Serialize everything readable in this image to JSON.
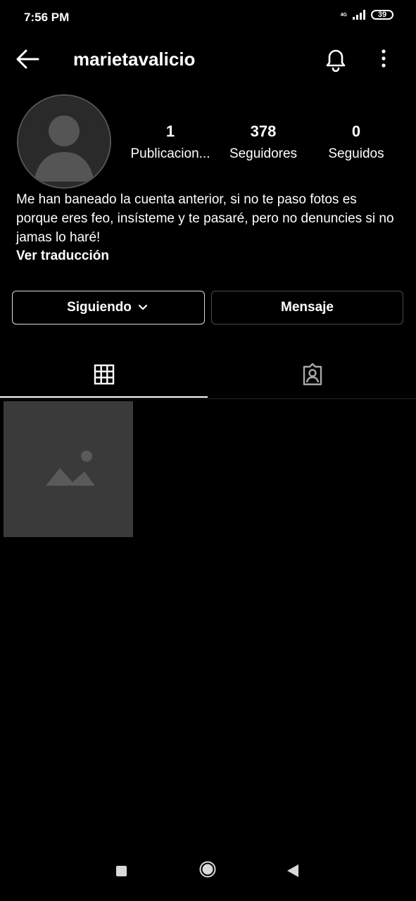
{
  "status_bar": {
    "time": "7:56 PM",
    "network": "4G",
    "battery": "39"
  },
  "header": {
    "username": "marietavalicio",
    "back_icon": "arrow-left-icon",
    "notifications_icon": "bell-icon",
    "more_icon": "more-vertical-icon"
  },
  "profile": {
    "avatar": "profile-photo",
    "stats": [
      {
        "value": "1",
        "label": "Publicacion..."
      },
      {
        "value": "378",
        "label": "Seguidores"
      },
      {
        "value": "0",
        "label": "Seguidos"
      }
    ],
    "bio": "Me han baneado la cuenta anterior, si no te paso fotos es porque eres feo, insísteme y te pasaré, pero no denuncies si no jamas lo haré!",
    "translate_link": "Ver traducción"
  },
  "actions": {
    "following_label": "Siguiendo",
    "message_label": "Mensaje"
  },
  "tabs": [
    {
      "icon": "grid-icon",
      "selected": true
    },
    {
      "icon": "tagged-person-icon",
      "selected": false
    }
  ],
  "posts": [
    {
      "thumbnail": "post-photo"
    }
  ],
  "colors": {
    "background": "#000000",
    "text": "#ffffff",
    "secondary_border": "#4a4a4a"
  }
}
